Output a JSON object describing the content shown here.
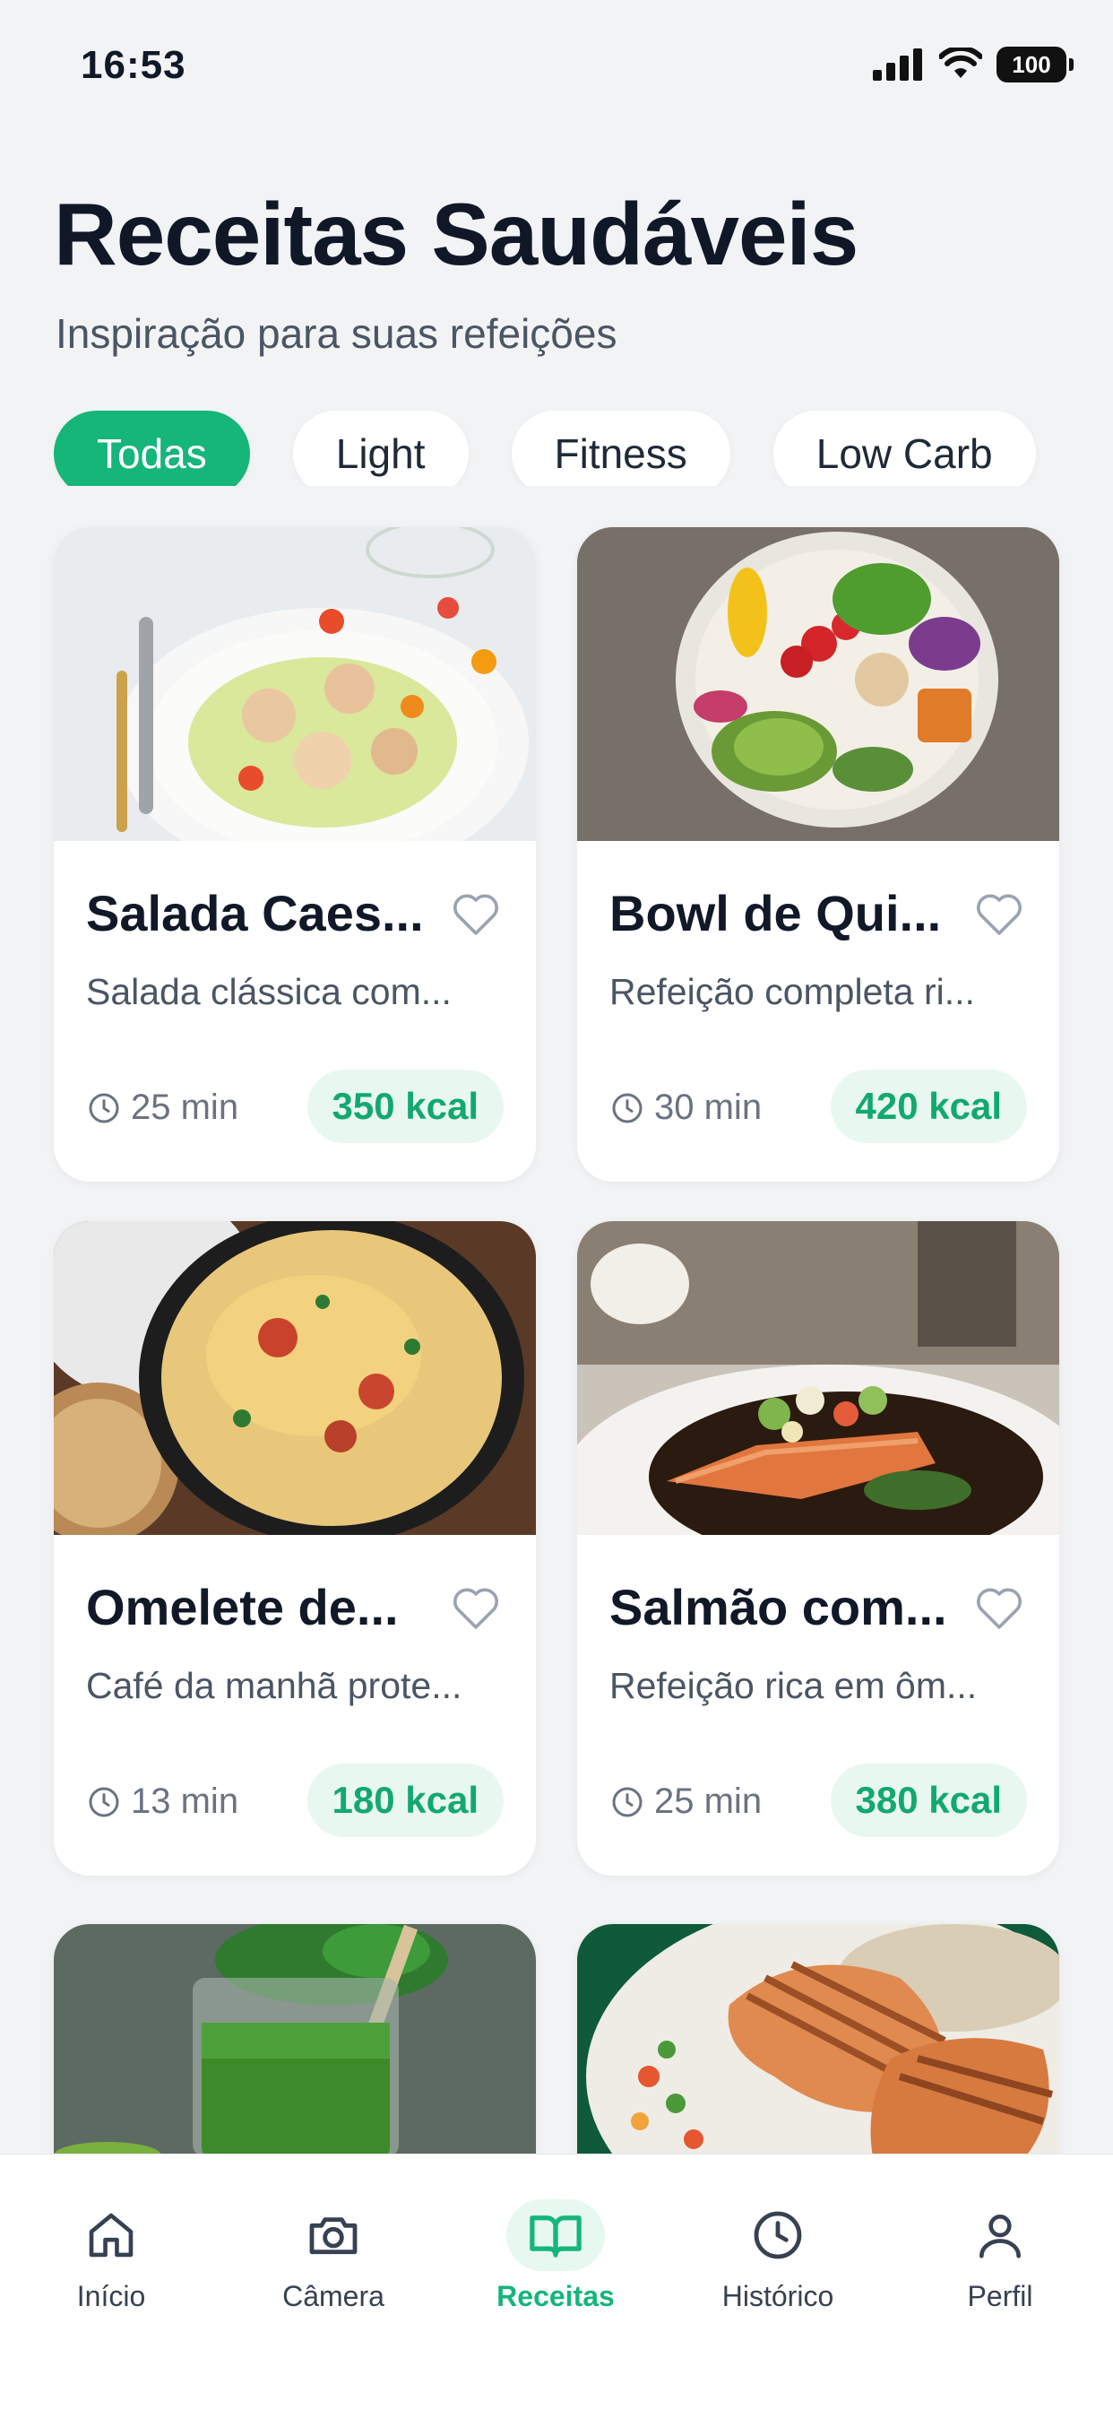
{
  "status_bar": {
    "time": "16:53",
    "battery": "100"
  },
  "header": {
    "title": "Receitas Saudáveis",
    "subtitle": "Inspiração para suas refeições"
  },
  "filters": [
    {
      "label": "Todas",
      "active": true
    },
    {
      "label": "Light",
      "active": false
    },
    {
      "label": "Fitness",
      "active": false
    },
    {
      "label": "Low Carb",
      "active": false
    }
  ],
  "recipes": [
    {
      "title": "Salada Caes...",
      "description": "Salada clássica com...",
      "time": "25 min",
      "kcal": "350 kcal"
    },
    {
      "title": "Bowl de Qui...",
      "description": "Refeição completa ri...",
      "time": "30 min",
      "kcal": "420 kcal"
    },
    {
      "title": "Omelete de...",
      "description": "Café da manhã prote...",
      "time": "13 min",
      "kcal": "180 kcal"
    },
    {
      "title": "Salmão com...",
      "description": "Refeição rica em ôm...",
      "time": "25 min",
      "kcal": "380 kcal"
    }
  ],
  "nav": [
    {
      "label": "Início",
      "icon": "home-icon",
      "active": false
    },
    {
      "label": "Câmera",
      "icon": "camera-icon",
      "active": false
    },
    {
      "label": "Receitas",
      "icon": "book-icon",
      "active": true
    },
    {
      "label": "Histórico",
      "icon": "clock-icon",
      "active": false
    },
    {
      "label": "Perfil",
      "icon": "user-icon",
      "active": false
    }
  ],
  "colors": {
    "accent": "#16b57a",
    "background": "#f2f3f5",
    "kcal_bg": "#e8f8f0"
  }
}
